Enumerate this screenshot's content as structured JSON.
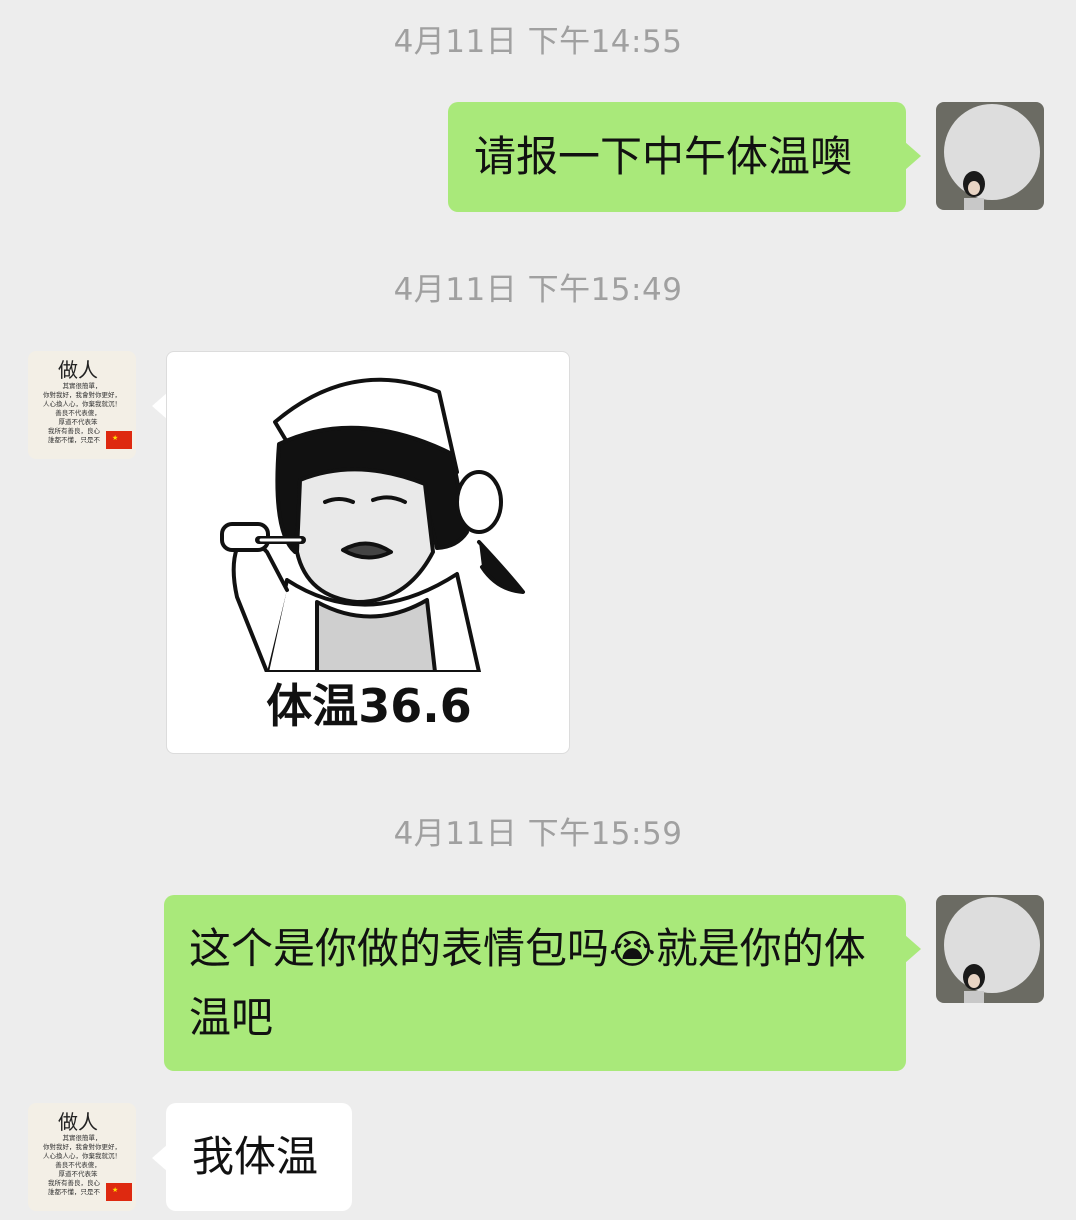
{
  "timestamps": [
    "4月11日 下午14:55",
    "4月11日 下午15:49",
    "4月11日 下午15:59"
  ],
  "messages": {
    "m1": {
      "sender": "me",
      "text": "请报一下中午体温噢"
    },
    "m2": {
      "sender": "other",
      "type": "sticker",
      "caption": "体温36.6"
    },
    "m3": {
      "sender": "me",
      "text_before": "这个是你做的表情包吗",
      "emoji": "😭",
      "text_after": "就是你的体温吧"
    },
    "m4": {
      "sender": "other",
      "text": "我体温"
    }
  },
  "other_avatar": {
    "title": "做人",
    "lines": [
      "其實很簡單，",
      "你對我好，我會對你更好，",
      "人心換人心，你棄我就沉！",
      "善良不代表傻，",
      "厚道不代表笨",
      "我所有善良，良心",
      "誰都不懂，只是不"
    ]
  },
  "colors": {
    "my_bubble": "#a9e97a",
    "other_bubble": "#ffffff",
    "background": "#ededed",
    "timestamp": "#a0a0a0"
  }
}
